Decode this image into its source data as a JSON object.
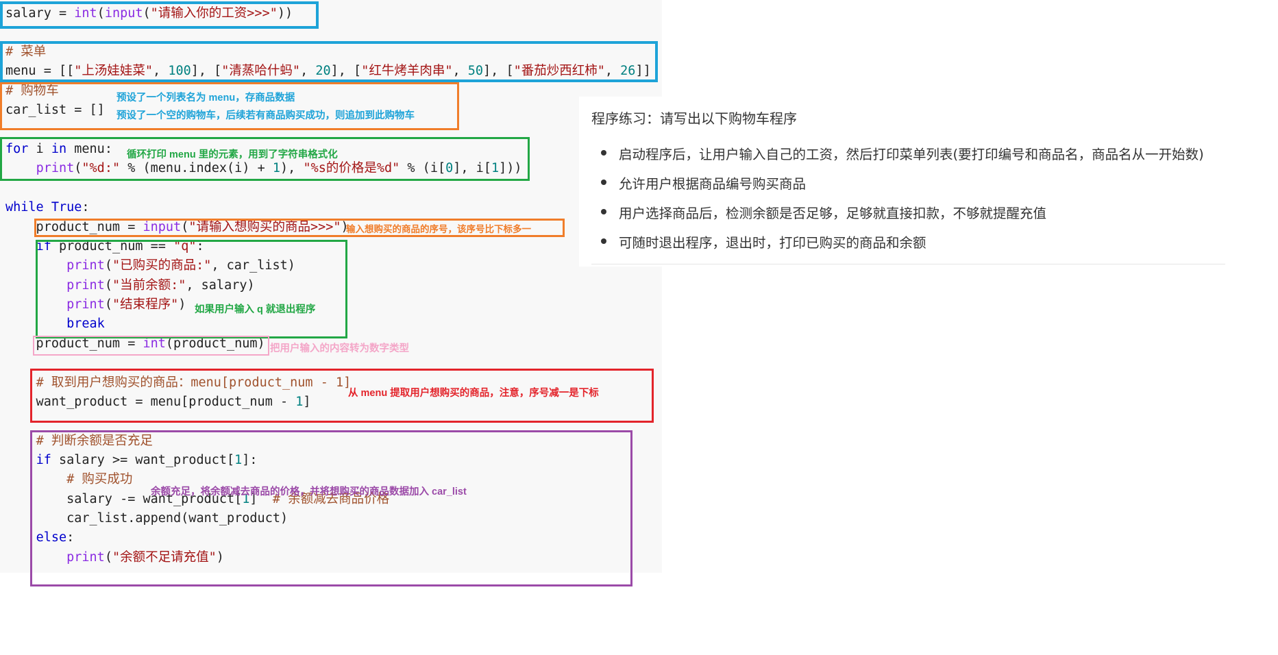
{
  "colors": {
    "keyword": "#0000cc",
    "builtin": "#8a2be2",
    "number": "#008080",
    "string": "#a31515",
    "comment": "#a0522d",
    "box_blue": "#1ea3d8",
    "box_orange": "#f07d2a",
    "box_green": "#22a745",
    "box_pink": "#f4a6c8",
    "box_red": "#e3242b",
    "box_purple": "#9b4aa8"
  },
  "code": {
    "l1": {
      "a": "salary = ",
      "b": "int",
      "c": "(",
      "d": "input",
      "e": "(",
      "f": "\"请输入你的工资>>>\"",
      "g": "))"
    },
    "l2": {
      "a": "# 菜单"
    },
    "l3": {
      "a": "menu = [[",
      "b": "\"上汤娃娃菜\"",
      "c": ", ",
      "d": "100",
      "e": "], [",
      "f": "\"清蒸哈什蚂\"",
      "g": ", ",
      "h": "20",
      "i": "], [",
      "j": "\"红牛烤羊肉串\"",
      "k": ", ",
      "l": "50",
      "m": "], [",
      "n": "\"番茄炒西红柿\"",
      "o": ", ",
      "p": "26",
      "q": "]]"
    },
    "l4": {
      "a": "# 购物车"
    },
    "l5": {
      "a": "car_list = []"
    },
    "l6": {
      "a": "for",
      "b": " i ",
      "c": "in",
      "d": " menu:"
    },
    "l7": {
      "a": "    ",
      "b": "print",
      "c": "(",
      "d": "\"%d:\"",
      "e": " % (menu.index(i) + ",
      "f": "1",
      "g": "), ",
      "h": "\"%s的价格是%d\"",
      "i": " % (i[",
      "j": "0",
      "k": "], i[",
      "l": "1",
      "m": "]))"
    },
    "l8": {
      "a": "while",
      "b": " ",
      "c": "True",
      "d": ":"
    },
    "l9": {
      "a": "    product_num = ",
      "b": "input",
      "c": "(",
      "d": "\"请输入想购买的商品>>>\"",
      "e": ")"
    },
    "l10": {
      "a": "    ",
      "b": "if",
      "c": " product_num == ",
      "d": "\"q\"",
      "e": ":"
    },
    "l11": {
      "a": "        ",
      "b": "print",
      "c": "(",
      "d": "\"已购买的商品:\"",
      "e": ", car_list)"
    },
    "l12": {
      "a": "        ",
      "b": "print",
      "c": "(",
      "d": "\"当前余额:\"",
      "e": ", salary)"
    },
    "l13": {
      "a": "        ",
      "b": "print",
      "c": "(",
      "d": "\"结束程序\"",
      "e": ")"
    },
    "l14": {
      "a": "        ",
      "b": "break"
    },
    "l15": {
      "a": "    product_num = ",
      "b": "int",
      "c": "(product_num)"
    },
    "l16": {
      "a": "    ",
      "b": "# 取到用户想购买的商品：",
      "c": "menu[product_num - 1]"
    },
    "l17": {
      "a": "    want_product = menu[product_num - ",
      "b": "1",
      "c": "]"
    },
    "l18": {
      "a": "    ",
      "b": "# 判断余额是否充足"
    },
    "l19": {
      "a": "    ",
      "b": "if",
      "c": " salary >= want_product[",
      "d": "1",
      "e": "]:"
    },
    "l20": {
      "a": "        ",
      "b": "# 购买成功"
    },
    "l21": {
      "a": "        salary -= want_product[",
      "b": "1",
      "c": "]  ",
      "d": "# 余额减去商品价格"
    },
    "l22": {
      "a": "        car_list.append(want_product)"
    },
    "l23": {
      "a": "    ",
      "b": "else",
      "c": ":"
    },
    "l24": {
      "a": "        ",
      "b": "print",
      "c": "(",
      "d": "\"余额不足请充值\"",
      "e": ")"
    }
  },
  "annotations": {
    "menu_note": "预设了一个列表名为 menu，存商品数据",
    "cart_note": "预设了一个空的购物车，后续若有商品购买成功，则追加到此购物车",
    "loop_note": "循环打印 menu 里的元素，用到了字符串格式化",
    "input_note": "输入想购买的商品的序号，该序号比下标多一",
    "quit_note": "如果用户输入 q 就退出程序",
    "int_note": "把用户输入的内容转为数字类型",
    "fetch_note": "从 menu 提取用户想购买的商品，注意，序号减一是下标",
    "balance_note": "余额充足，将余额减去商品的价格，并将想购买的商品数据加入 car_list"
  },
  "exercise": {
    "title": "程序练习：请写出以下购物车程序",
    "items": [
      "启动程序后，让用户输入自己的工资，然后打印菜单列表(要打印编号和商品名，商品名从一开始数)",
      "允许用户根据商品编号购买商品",
      "用户选择商品后，检测余额是否足够，足够就直接扣款，不够就提醒充值",
      "可随时退出程序，退出时，打印已购买的商品和余额"
    ]
  }
}
